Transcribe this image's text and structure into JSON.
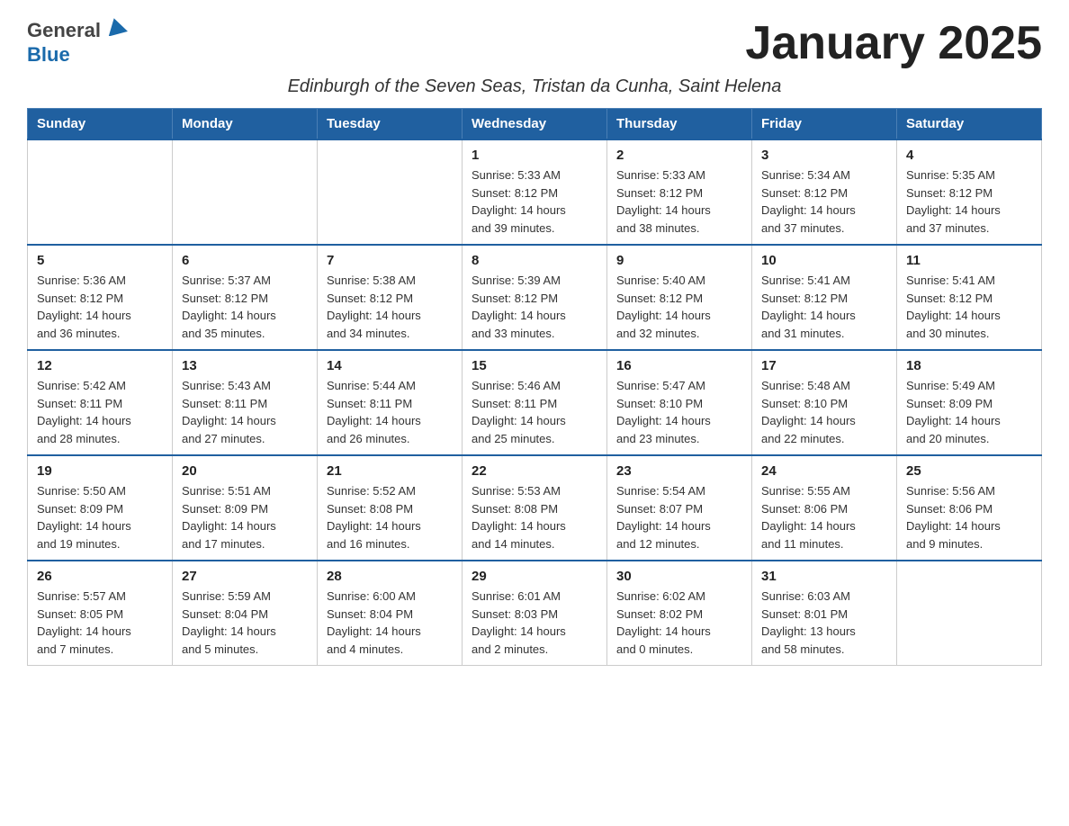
{
  "header": {
    "title": "January 2025",
    "subtitle": "Edinburgh of the Seven Seas, Tristan da Cunha, Saint Helena",
    "logo_general": "General",
    "logo_blue": "Blue"
  },
  "calendar": {
    "days_of_week": [
      "Sunday",
      "Monday",
      "Tuesday",
      "Wednesday",
      "Thursday",
      "Friday",
      "Saturday"
    ],
    "weeks": [
      [
        {
          "date": "",
          "info": ""
        },
        {
          "date": "",
          "info": ""
        },
        {
          "date": "",
          "info": ""
        },
        {
          "date": "1",
          "info": "Sunrise: 5:33 AM\nSunset: 8:12 PM\nDaylight: 14 hours\nand 39 minutes."
        },
        {
          "date": "2",
          "info": "Sunrise: 5:33 AM\nSunset: 8:12 PM\nDaylight: 14 hours\nand 38 minutes."
        },
        {
          "date": "3",
          "info": "Sunrise: 5:34 AM\nSunset: 8:12 PM\nDaylight: 14 hours\nand 37 minutes."
        },
        {
          "date": "4",
          "info": "Sunrise: 5:35 AM\nSunset: 8:12 PM\nDaylight: 14 hours\nand 37 minutes."
        }
      ],
      [
        {
          "date": "5",
          "info": "Sunrise: 5:36 AM\nSunset: 8:12 PM\nDaylight: 14 hours\nand 36 minutes."
        },
        {
          "date": "6",
          "info": "Sunrise: 5:37 AM\nSunset: 8:12 PM\nDaylight: 14 hours\nand 35 minutes."
        },
        {
          "date": "7",
          "info": "Sunrise: 5:38 AM\nSunset: 8:12 PM\nDaylight: 14 hours\nand 34 minutes."
        },
        {
          "date": "8",
          "info": "Sunrise: 5:39 AM\nSunset: 8:12 PM\nDaylight: 14 hours\nand 33 minutes."
        },
        {
          "date": "9",
          "info": "Sunrise: 5:40 AM\nSunset: 8:12 PM\nDaylight: 14 hours\nand 32 minutes."
        },
        {
          "date": "10",
          "info": "Sunrise: 5:41 AM\nSunset: 8:12 PM\nDaylight: 14 hours\nand 31 minutes."
        },
        {
          "date": "11",
          "info": "Sunrise: 5:41 AM\nSunset: 8:12 PM\nDaylight: 14 hours\nand 30 minutes."
        }
      ],
      [
        {
          "date": "12",
          "info": "Sunrise: 5:42 AM\nSunset: 8:11 PM\nDaylight: 14 hours\nand 28 minutes."
        },
        {
          "date": "13",
          "info": "Sunrise: 5:43 AM\nSunset: 8:11 PM\nDaylight: 14 hours\nand 27 minutes."
        },
        {
          "date": "14",
          "info": "Sunrise: 5:44 AM\nSunset: 8:11 PM\nDaylight: 14 hours\nand 26 minutes."
        },
        {
          "date": "15",
          "info": "Sunrise: 5:46 AM\nSunset: 8:11 PM\nDaylight: 14 hours\nand 25 minutes."
        },
        {
          "date": "16",
          "info": "Sunrise: 5:47 AM\nSunset: 8:10 PM\nDaylight: 14 hours\nand 23 minutes."
        },
        {
          "date": "17",
          "info": "Sunrise: 5:48 AM\nSunset: 8:10 PM\nDaylight: 14 hours\nand 22 minutes."
        },
        {
          "date": "18",
          "info": "Sunrise: 5:49 AM\nSunset: 8:09 PM\nDaylight: 14 hours\nand 20 minutes."
        }
      ],
      [
        {
          "date": "19",
          "info": "Sunrise: 5:50 AM\nSunset: 8:09 PM\nDaylight: 14 hours\nand 19 minutes."
        },
        {
          "date": "20",
          "info": "Sunrise: 5:51 AM\nSunset: 8:09 PM\nDaylight: 14 hours\nand 17 minutes."
        },
        {
          "date": "21",
          "info": "Sunrise: 5:52 AM\nSunset: 8:08 PM\nDaylight: 14 hours\nand 16 minutes."
        },
        {
          "date": "22",
          "info": "Sunrise: 5:53 AM\nSunset: 8:08 PM\nDaylight: 14 hours\nand 14 minutes."
        },
        {
          "date": "23",
          "info": "Sunrise: 5:54 AM\nSunset: 8:07 PM\nDaylight: 14 hours\nand 12 minutes."
        },
        {
          "date": "24",
          "info": "Sunrise: 5:55 AM\nSunset: 8:06 PM\nDaylight: 14 hours\nand 11 minutes."
        },
        {
          "date": "25",
          "info": "Sunrise: 5:56 AM\nSunset: 8:06 PM\nDaylight: 14 hours\nand 9 minutes."
        }
      ],
      [
        {
          "date": "26",
          "info": "Sunrise: 5:57 AM\nSunset: 8:05 PM\nDaylight: 14 hours\nand 7 minutes."
        },
        {
          "date": "27",
          "info": "Sunrise: 5:59 AM\nSunset: 8:04 PM\nDaylight: 14 hours\nand 5 minutes."
        },
        {
          "date": "28",
          "info": "Sunrise: 6:00 AM\nSunset: 8:04 PM\nDaylight: 14 hours\nand 4 minutes."
        },
        {
          "date": "29",
          "info": "Sunrise: 6:01 AM\nSunset: 8:03 PM\nDaylight: 14 hours\nand 2 minutes."
        },
        {
          "date": "30",
          "info": "Sunrise: 6:02 AM\nSunset: 8:02 PM\nDaylight: 14 hours\nand 0 minutes."
        },
        {
          "date": "31",
          "info": "Sunrise: 6:03 AM\nSunset: 8:01 PM\nDaylight: 13 hours\nand 58 minutes."
        },
        {
          "date": "",
          "info": ""
        }
      ]
    ]
  }
}
